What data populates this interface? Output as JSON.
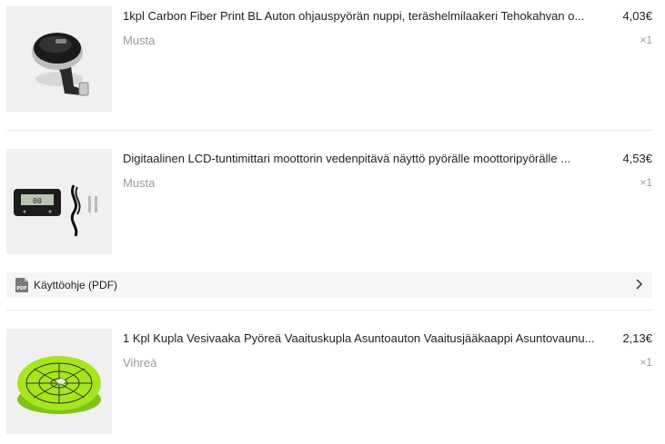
{
  "items": [
    {
      "title": "1kpl Carbon Fiber Print BL Auton ohjauspyörän nuppi, teräshelmilaakeri Tehokahvan o...",
      "variant": "Musta",
      "price": "4,03€",
      "quantity": "×1",
      "image_icon": "steering-knob-product-image"
    },
    {
      "title": "Digitaalinen LCD-tuntimittari moottorin vedenpitävä näyttö pyörälle moottoripyörälle ...",
      "variant": "Musta",
      "price": "4,53€",
      "quantity": "×1",
      "image_icon": "hour-meter-product-image"
    },
    {
      "title": "1 Kpl Kupla Vesivaaka Pyöreä Vaaituskupla Asuntoauton Vaaitusjääkaappi Asuntovaunu...",
      "variant": "Vihreä",
      "price": "2,13€",
      "quantity": "×1",
      "image_icon": "bubble-level-product-image"
    }
  ],
  "manual": {
    "label": "Käyttöohje (PDF)",
    "icon": "pdf-icon",
    "chevron": "chevron-right-icon",
    "icon_text": "PDF"
  },
  "colors": {
    "text": "#222222",
    "muted": "#9a9a9a",
    "divider": "#e8e8e8",
    "row_bg": "#f5f5f5"
  }
}
